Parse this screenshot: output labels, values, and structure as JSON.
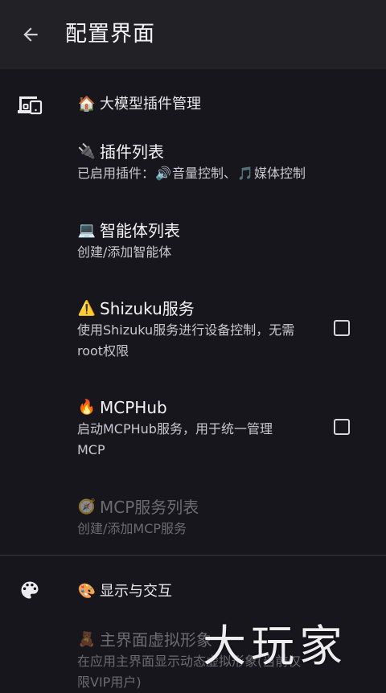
{
  "app_bar": {
    "title": "配置界面",
    "back_icon": "arrow-back-icon"
  },
  "categories": [
    {
      "icon": "devices-icon",
      "title_emoji": "🏠",
      "title": "大模型插件管理"
    },
    {
      "icon": "palette-icon",
      "title_emoji": "🎨",
      "title": "显示与交互"
    }
  ],
  "prefs": {
    "plugin_list": {
      "emoji": "🔌",
      "title": "插件列表",
      "summary_prefix": "已启用插件：",
      "plugin1_emoji": "🔊",
      "plugin1": "音量控制、",
      "plugin2_emoji": "🎵",
      "plugin2": "媒体控制"
    },
    "agent_list": {
      "emoji": "💻",
      "title": "智能体列表",
      "summary": "创建/添加智能体"
    },
    "shizuku": {
      "emoji": "⚠️",
      "title": "Shizuku服务",
      "summary": "使用Shizuku服务进行设备控制，无需root权限",
      "checked": false
    },
    "mcphub": {
      "emoji": "🔥",
      "title": "MCPHub",
      "summary": "启动MCPHub服务，用于统一管理MCP",
      "checked": false
    },
    "mcp_list": {
      "emoji": "🧭",
      "title": "MCP服务列表",
      "summary": "创建/添加MCP服务",
      "enabled": false
    },
    "avatar": {
      "emoji": "🧸",
      "title": "主界面虚拟形象",
      "summary": "在应用主界面显示动态虚拟形象(当前仅限VIP用户)"
    }
  },
  "watermark": "大玩家",
  "colors": {
    "background": "#17161c",
    "app_bar": "#222126",
    "divider": "#3a3940",
    "disabled_text": "#6c6b72"
  }
}
